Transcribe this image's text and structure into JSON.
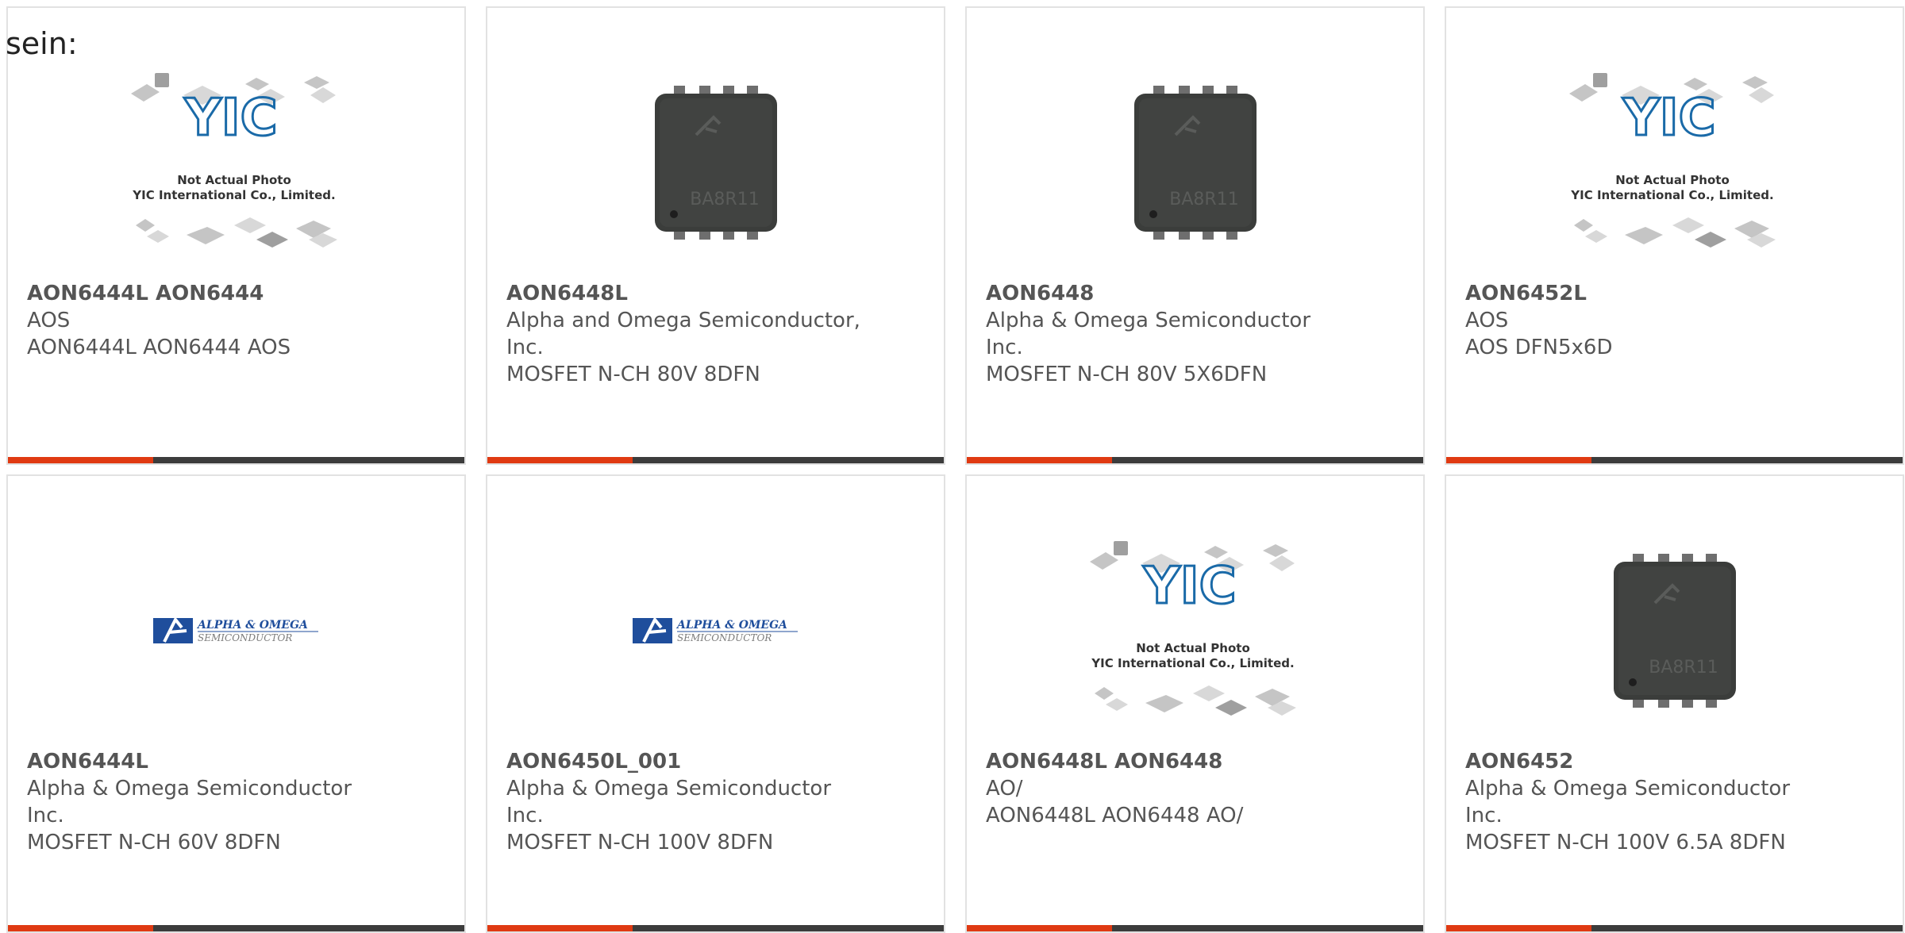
{
  "page": {
    "heading": "sein:"
  },
  "colors": {
    "accent_bar": "#e03a12",
    "bar_rest": "#3c3c3c",
    "card_border": "#e2e2e2",
    "text": "#555555"
  },
  "placeholder_image": {
    "line1": "Not Actual Photo",
    "line2": "YIC International Co., Limited."
  },
  "logo_image": {
    "line1": "ALPHA & OMEGA",
    "line2": "SEMICONDUCTOR"
  },
  "chip_image": {
    "marking": "BA8R11"
  },
  "products": [
    {
      "image_type": "placeholder",
      "part": "AON6444L AON6444",
      "lines": [
        "AOS",
        "AON6444L AON6444 AOS"
      ]
    },
    {
      "image_type": "chip",
      "part": "AON6448L",
      "lines": [
        "Alpha and Omega Semiconductor,",
        "Inc.",
        "MOSFET N-CH 80V 8DFN"
      ]
    },
    {
      "image_type": "chip",
      "part": "AON6448",
      "lines": [
        "Alpha & Omega Semiconductor",
        "Inc.",
        "MOSFET N-CH 80V 5X6DFN"
      ]
    },
    {
      "image_type": "placeholder",
      "part": "AON6452L",
      "lines": [
        "AOS",
        "AOS DFN5x6D"
      ]
    },
    {
      "image_type": "logo",
      "part": "AON6444L",
      "lines": [
        "Alpha & Omega Semiconductor",
        "Inc.",
        "MOSFET N-CH 60V 8DFN"
      ]
    },
    {
      "image_type": "logo",
      "part": "AON6450L_001",
      "lines": [
        "Alpha & Omega Semiconductor",
        "Inc.",
        "MOSFET N-CH 100V 8DFN"
      ]
    },
    {
      "image_type": "placeholder",
      "part": "AON6448L AON6448",
      "lines": [
        "AO/",
        "AON6448L AON6448 AO/"
      ]
    },
    {
      "image_type": "chip",
      "part": "AON6452",
      "lines": [
        "Alpha & Omega Semiconductor",
        "Inc.",
        "MOSFET N-CH 100V 6.5A 8DFN"
      ]
    }
  ]
}
